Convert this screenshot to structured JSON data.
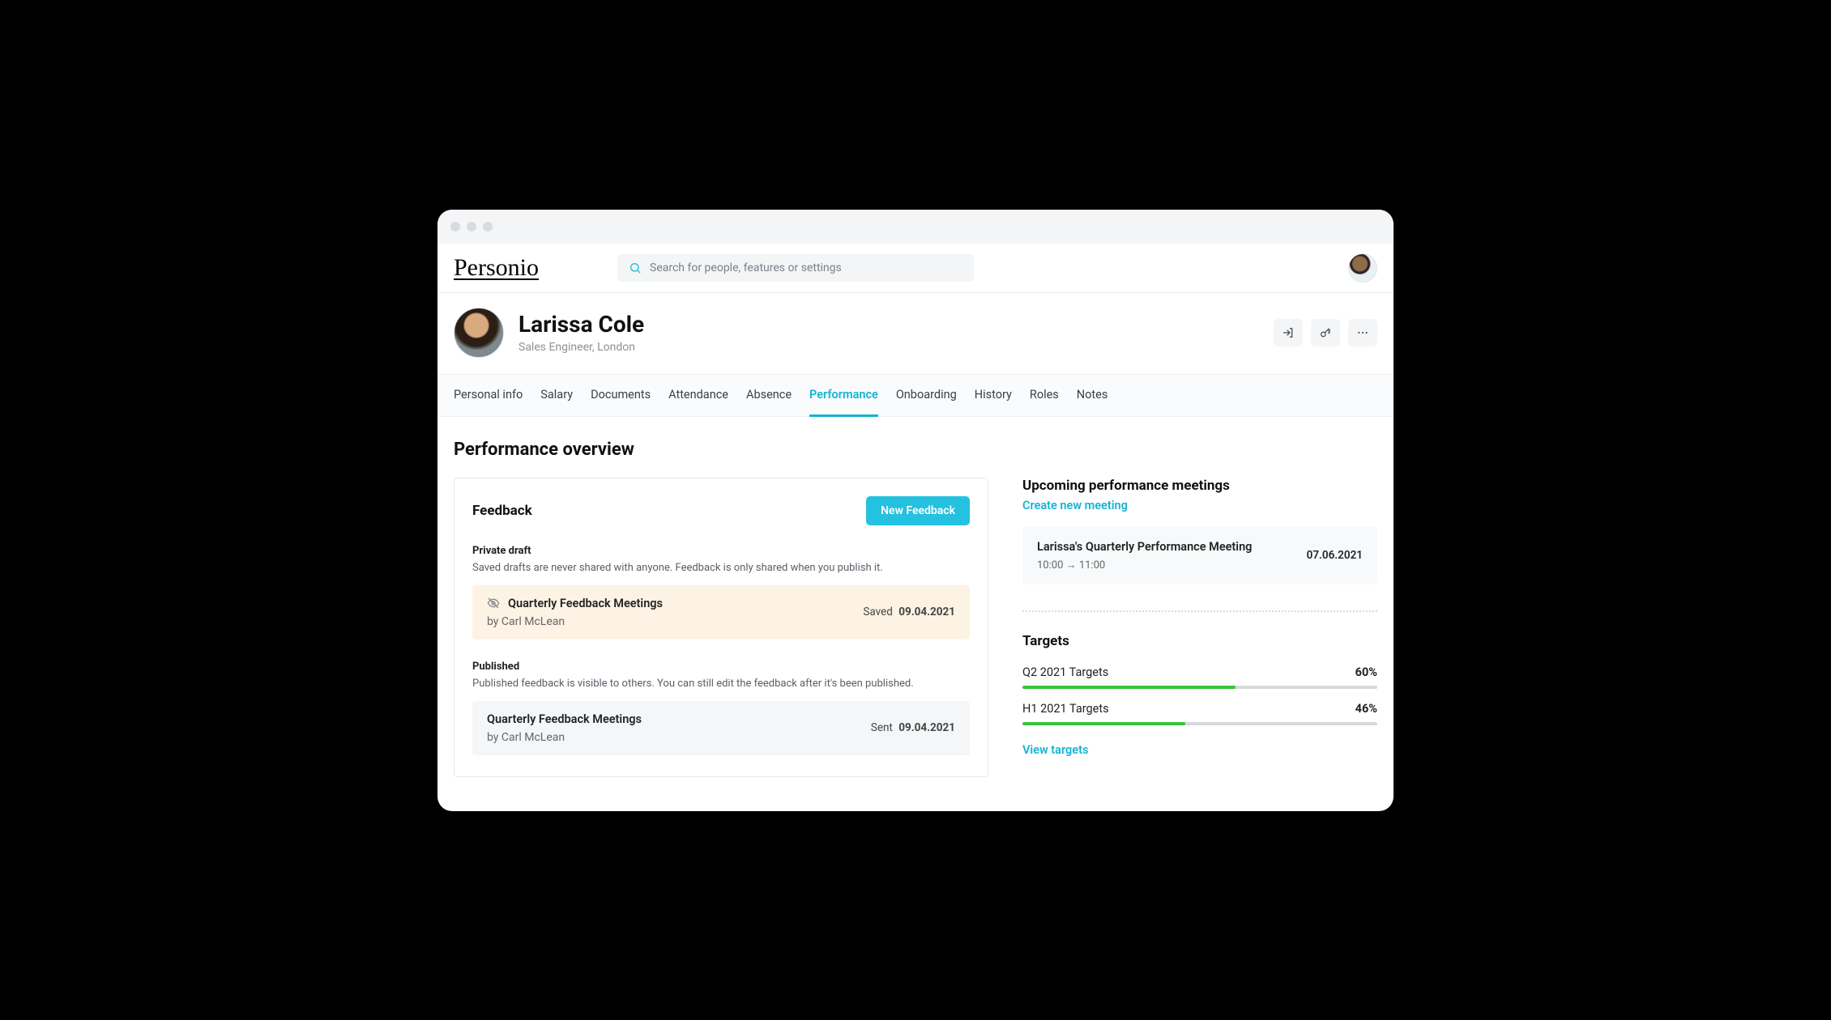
{
  "brand": "Personio",
  "search": {
    "placeholder": "Search for people, features or settings"
  },
  "profile": {
    "name": "Larissa Cole",
    "subtitle": "Sales Engineer, London"
  },
  "tabs": [
    {
      "label": "Personal info"
    },
    {
      "label": "Salary"
    },
    {
      "label": "Documents"
    },
    {
      "label": "Attendance"
    },
    {
      "label": "Absence"
    },
    {
      "label": "Performance",
      "active": true
    },
    {
      "label": "Onboarding"
    },
    {
      "label": "History"
    },
    {
      "label": "Roles"
    },
    {
      "label": "Notes"
    }
  ],
  "page_title": "Performance overview",
  "feedback": {
    "heading": "Feedback",
    "new_button": "New Feedback",
    "draft": {
      "label": "Private draft",
      "help": "Saved drafts are never shared with anyone. Feedback is only shared when you publish it.",
      "item": {
        "title": "Quarterly Feedback Meetings",
        "author_prefix": "by ",
        "author": "Carl McLean",
        "status": "Saved",
        "date": "09.04.2021"
      }
    },
    "published": {
      "label": "Published",
      "help": "Published feedback is visible to others. You can still edit the feedback after it's been published.",
      "item": {
        "title": "Quarterly Feedback Meetings",
        "author_prefix": "by ",
        "author": "Carl McLean",
        "status": "Sent",
        "date": "09.04.2021"
      }
    }
  },
  "meetings": {
    "heading": "Upcoming performance meetings",
    "create_link": "Create new meeting",
    "item": {
      "title": "Larissa's Quarterly Performance Meeting",
      "time": "10:00 → 11:00",
      "date": "07.06.2021"
    }
  },
  "targets": {
    "heading": "Targets",
    "items": [
      {
        "label": "Q2 2021 Targets",
        "pct": "60%",
        "pct_num": 60
      },
      {
        "label": "H1 2021 Targets",
        "pct": "46%",
        "pct_num": 46
      }
    ],
    "view_link": "View targets"
  }
}
